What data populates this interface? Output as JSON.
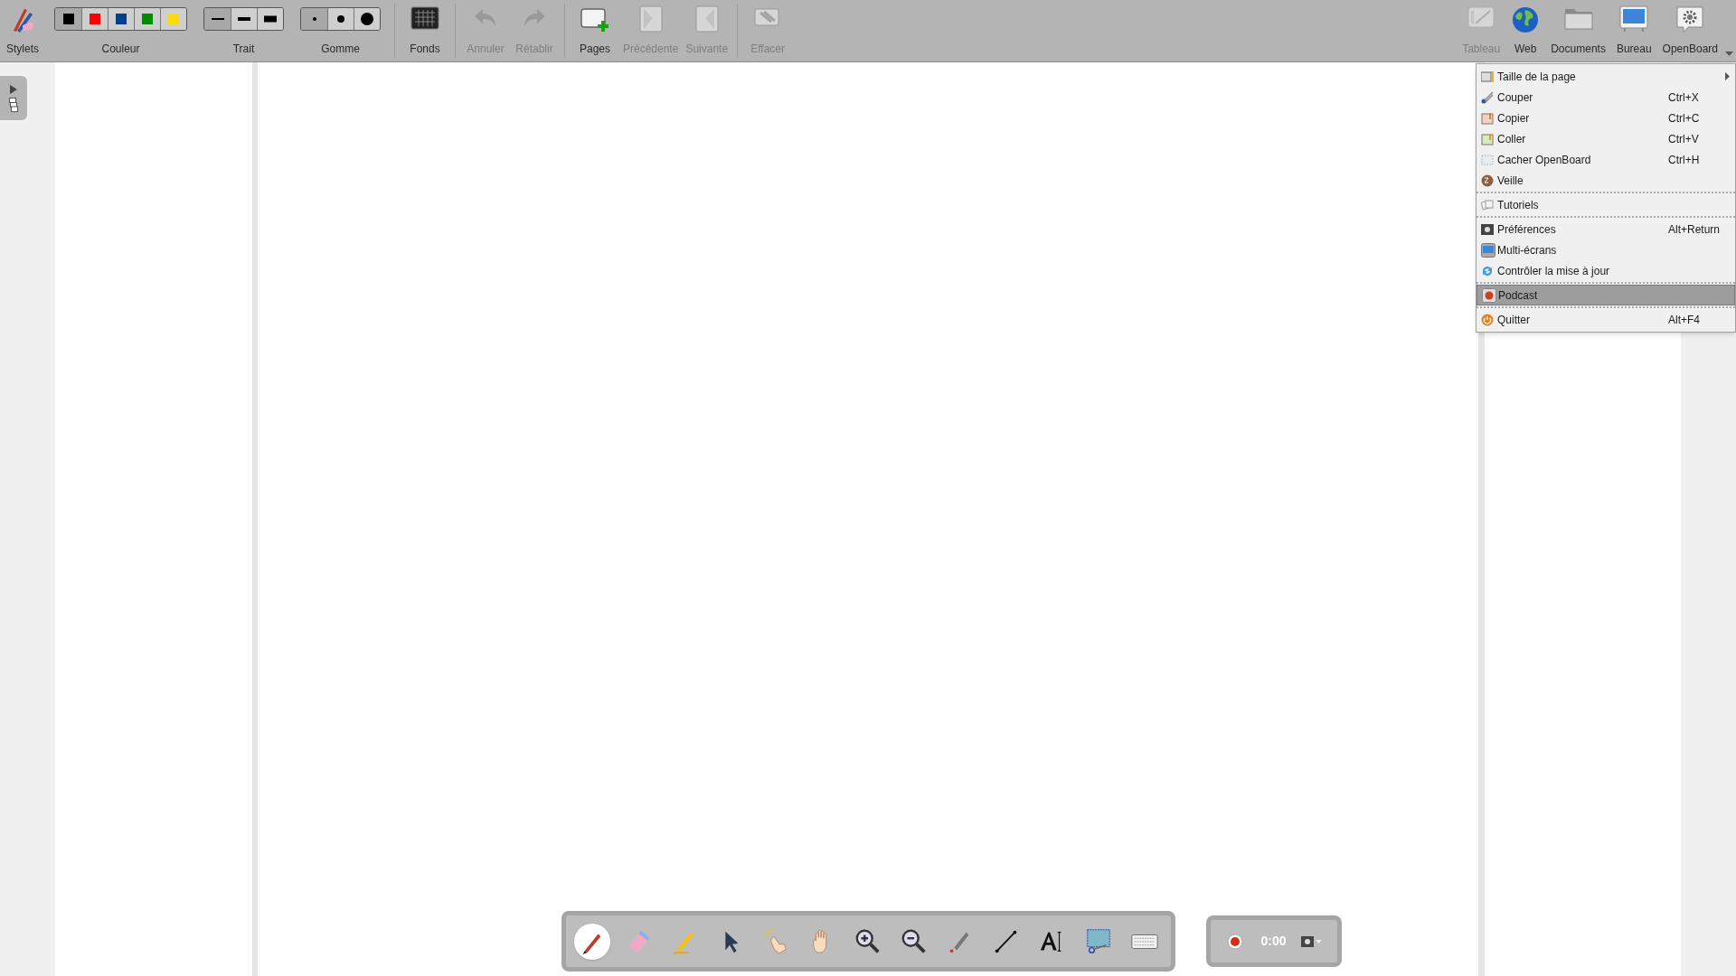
{
  "toolbar_left": [
    {
      "kind": "tool",
      "label": "Stylets",
      "disabled": false
    },
    {
      "kind": "segments",
      "label": "Couleur",
      "items": [
        {
          "color": "#000000",
          "selected": true
        },
        {
          "color": "#ff0000",
          "selected": false
        },
        {
          "color": "#003f8a",
          "selected": false
        },
        {
          "color": "#008a00",
          "selected": false
        },
        {
          "color": "#ffdc00",
          "selected": false
        }
      ]
    },
    {
      "kind": "segments",
      "label": "Trait",
      "items": [
        {
          "selected": true
        },
        {
          "selected": false
        },
        {
          "selected": false
        }
      ]
    },
    {
      "kind": "segments",
      "label": "Gomme",
      "items": [
        {
          "selected": true
        },
        {
          "selected": false
        },
        {
          "selected": false
        }
      ]
    },
    {
      "kind": "separator"
    },
    {
      "kind": "tool",
      "label": "Fonds",
      "disabled": false
    },
    {
      "kind": "separator"
    },
    {
      "kind": "tool",
      "label": "Annuler",
      "disabled": true
    },
    {
      "kind": "tool",
      "label": "Rétablir",
      "disabled": true
    },
    {
      "kind": "separator"
    },
    {
      "kind": "tool",
      "label": "Pages",
      "disabled": false
    },
    {
      "kind": "tool",
      "label": "Précédente",
      "disabled": true
    },
    {
      "kind": "tool",
      "label": "Suivante",
      "disabled": true
    },
    {
      "kind": "separator"
    },
    {
      "kind": "tool",
      "label": "Effacer",
      "disabled": true
    }
  ],
  "toolbar_right": [
    {
      "label": "Tableau",
      "disabled": true
    },
    {
      "label": "Web",
      "disabled": false
    },
    {
      "label": "Documents",
      "disabled": false
    },
    {
      "label": "Bureau",
      "disabled": false
    },
    {
      "label": "OpenBoard",
      "disabled": false
    }
  ],
  "menu": [
    {
      "kind": "item",
      "label": "Taille de la page",
      "submenu": true,
      "selected": false
    },
    {
      "kind": "item",
      "label": "Couper",
      "shortcut": "Ctrl+X",
      "selected": false
    },
    {
      "kind": "item",
      "label": "Copier",
      "shortcut": "Ctrl+C",
      "selected": false
    },
    {
      "kind": "item",
      "label": "Coller",
      "shortcut": "Ctrl+V",
      "selected": false
    },
    {
      "kind": "item",
      "label": "Cacher OpenBoard",
      "shortcut": "Ctrl+H",
      "selected": false
    },
    {
      "kind": "item",
      "label": "Veille",
      "selected": false
    },
    {
      "kind": "separator"
    },
    {
      "kind": "item",
      "label": "Tutoriels",
      "selected": false
    },
    {
      "kind": "separator"
    },
    {
      "kind": "item",
      "label": "Préférences",
      "shortcut": "Alt+Return",
      "selected": false
    },
    {
      "kind": "item",
      "label": "Multi-écrans",
      "selected": false
    },
    {
      "kind": "item",
      "label": "Contrôler la mise à jour",
      "selected": false
    },
    {
      "kind": "separator"
    },
    {
      "kind": "item",
      "label": "Podcast",
      "selected": true
    },
    {
      "kind": "separator"
    },
    {
      "kind": "item",
      "label": "Quitter",
      "shortcut": "Alt+F4",
      "selected": false
    }
  ],
  "board_tools": [
    {
      "selected": true
    },
    {
      "selected": false
    },
    {
      "selected": false
    },
    {
      "selected": false
    },
    {
      "selected": false
    },
    {
      "selected": false
    },
    {
      "selected": false
    },
    {
      "selected": false
    },
    {
      "selected": false
    },
    {
      "selected": false
    },
    {
      "selected": false
    },
    {
      "selected": false
    },
    {
      "selected": false
    }
  ],
  "podcast": {
    "timer": "0:00"
  }
}
